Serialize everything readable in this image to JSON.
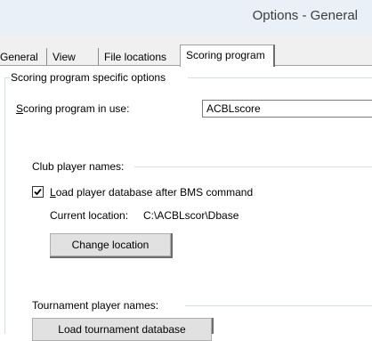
{
  "window": {
    "title": "Options - General"
  },
  "tabs": [
    {
      "label": "General"
    },
    {
      "label": "View"
    },
    {
      "label": "File locations"
    },
    {
      "label": "Scoring program"
    }
  ],
  "active_tab": "Scoring program",
  "scoring_group": {
    "label": "Scoring program specific options",
    "program_label": "Scoring program in use:",
    "program_value": "ACBLscore"
  },
  "club": {
    "label": "Club player names:",
    "load_checkbox_label": "Load player database after BMS command",
    "load_checked": true,
    "current_location_label": "Current location:",
    "current_location_value": "C:\\ACBLscor\\Dbase",
    "change_location_button": "Change location"
  },
  "tournament": {
    "label": "Tournament player names:",
    "load_button": "Load tournament database"
  }
}
